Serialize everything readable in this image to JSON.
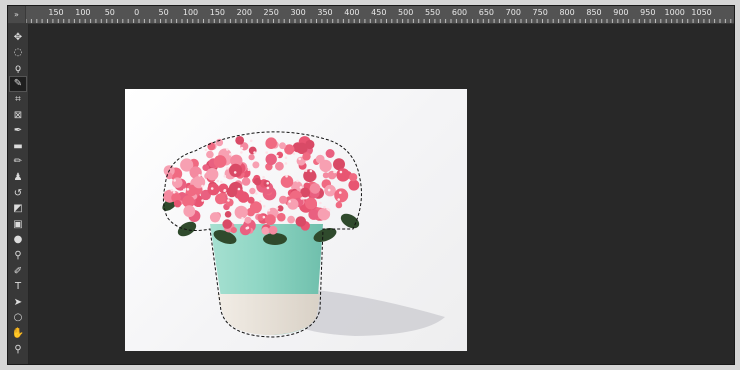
{
  "ruler": {
    "corner_icon": "double-chevron-icon",
    "corner_glyph": "»",
    "labels": [
      "150",
      "100",
      "50",
      "0",
      "50",
      "100",
      "150",
      "200",
      "250",
      "300",
      "350",
      "400",
      "450",
      "500",
      "550",
      "600",
      "650",
      "700",
      "750",
      "800",
      "850",
      "900",
      "950",
      "1000",
      "1050"
    ]
  },
  "toolbar": {
    "tools": [
      {
        "name": "move-tool",
        "icon": "move-icon",
        "glyph": "✥"
      },
      {
        "name": "marquee-tool",
        "icon": "ellipse-marquee-icon",
        "glyph": "◌"
      },
      {
        "name": "lasso-tool",
        "icon": "lasso-icon",
        "glyph": "ϙ"
      },
      {
        "name": "quick-selection-tool",
        "icon": "quick-selection-icon",
        "glyph": "✎",
        "active": true
      },
      {
        "name": "crop-tool",
        "icon": "crop-icon",
        "glyph": "⌗"
      },
      {
        "name": "frame-tool",
        "icon": "frame-icon",
        "glyph": "⊠"
      },
      {
        "name": "eyedropper-tool",
        "icon": "eyedropper-icon",
        "glyph": "✒"
      },
      {
        "name": "healing-brush-tool",
        "icon": "bandage-icon",
        "glyph": "▬"
      },
      {
        "name": "brush-tool",
        "icon": "brush-icon",
        "glyph": "✏"
      },
      {
        "name": "clone-stamp-tool",
        "icon": "stamp-icon",
        "glyph": "♟"
      },
      {
        "name": "history-brush-tool",
        "icon": "history-brush-icon",
        "glyph": "↺"
      },
      {
        "name": "eraser-tool",
        "icon": "eraser-icon",
        "glyph": "◩"
      },
      {
        "name": "gradient-tool",
        "icon": "gradient-icon",
        "glyph": "▣"
      },
      {
        "name": "blur-tool",
        "icon": "drop-icon",
        "glyph": "●"
      },
      {
        "name": "dodge-tool",
        "icon": "dodge-icon",
        "glyph": "⚲"
      },
      {
        "name": "pen-tool",
        "icon": "pen-icon",
        "glyph": "✐"
      },
      {
        "name": "type-tool",
        "icon": "type-icon",
        "glyph": "T"
      },
      {
        "name": "path-selection-tool",
        "icon": "arrow-icon",
        "glyph": "➤"
      },
      {
        "name": "shape-tool",
        "icon": "ellipse-icon",
        "glyph": "○"
      },
      {
        "name": "hand-tool",
        "icon": "hand-icon",
        "glyph": "✋"
      },
      {
        "name": "zoom-tool",
        "icon": "magnifier-icon",
        "glyph": "⚲"
      }
    ]
  },
  "canvas": {
    "image": "potted-pink-flowers-photo",
    "selection": "marching-ants-outline"
  },
  "colors": {
    "pot": "#8fd6c4",
    "pot_base": "#ece6de",
    "petal": "#f06a82",
    "leaf": "#2f4a2c",
    "window_bg": "#282828"
  }
}
